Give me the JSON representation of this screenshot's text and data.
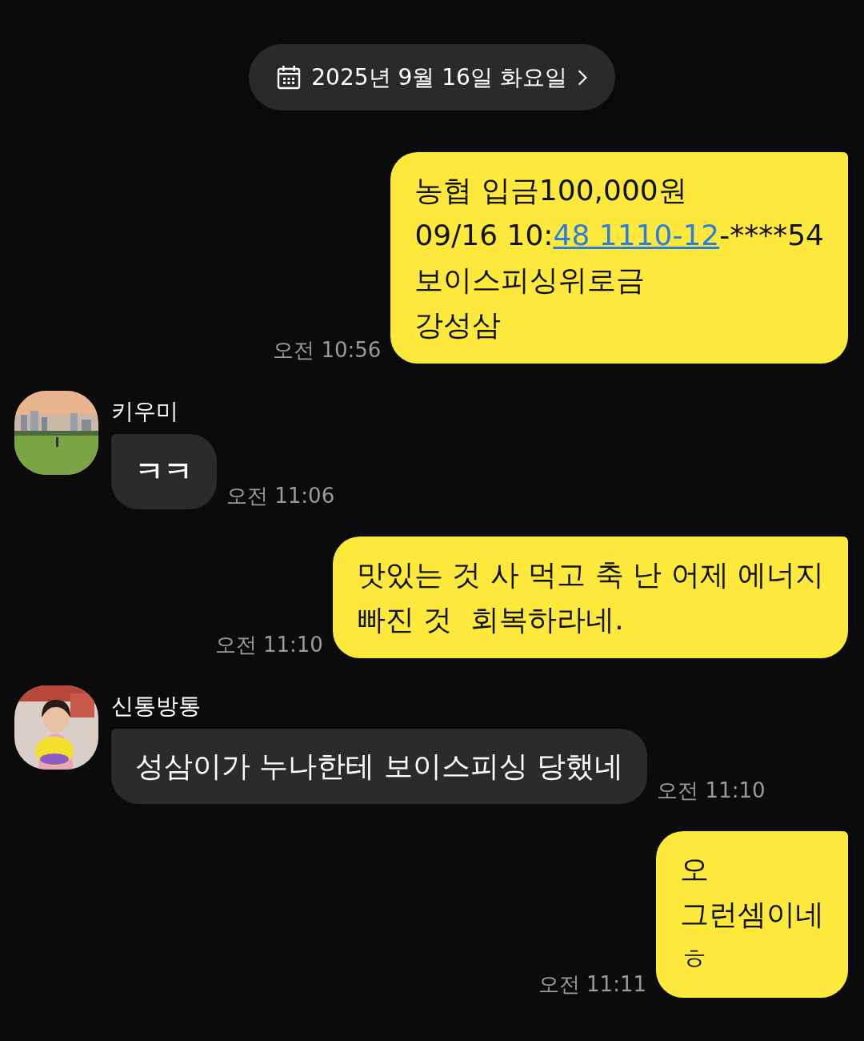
{
  "date_pill": {
    "label": "2025년 9월 16일 화요일"
  },
  "messages": [
    {
      "kind": "sent",
      "time": "오전 10:56",
      "lines": [
        [
          {
            "kind": "text",
            "text": "농협 입금100,000원"
          }
        ],
        [
          {
            "kind": "text",
            "text": "09/16 10:"
          },
          {
            "kind": "link",
            "text": "48 1110-12"
          },
          {
            "kind": "text",
            "text": "-****54"
          }
        ],
        [
          {
            "kind": "text",
            "text": "보이스피싱위로금"
          }
        ],
        [
          {
            "kind": "text",
            "text": "강성삼"
          }
        ]
      ]
    },
    {
      "kind": "received",
      "sender": "키우미",
      "bold": true,
      "time": "오전 11:06",
      "lines": [
        [
          {
            "kind": "text",
            "text": "ㅋㅋ"
          }
        ]
      ]
    },
    {
      "kind": "sent",
      "time": "오전 11:10",
      "lines": [
        [
          {
            "kind": "text",
            "text": "맛있는 것 사 먹고 축 난 어제 에너지"
          }
        ],
        [
          {
            "kind": "text",
            "text": "빠진 것  회복하라네."
          }
        ]
      ]
    },
    {
      "kind": "received",
      "sender": "신통방통",
      "bold": false,
      "time": "오전 11:10",
      "lines": [
        [
          {
            "kind": "text",
            "text": "성삼이가 누나한테 보이스피싱 당했네"
          }
        ]
      ]
    },
    {
      "kind": "sent",
      "time": "오전 11:11",
      "lines": [
        [
          {
            "kind": "text",
            "text": "오"
          }
        ],
        [
          {
            "kind": "text",
            "text": "그런셈이네"
          }
        ],
        [
          {
            "kind": "text",
            "text": "ㅎ"
          }
        ]
      ]
    }
  ]
}
